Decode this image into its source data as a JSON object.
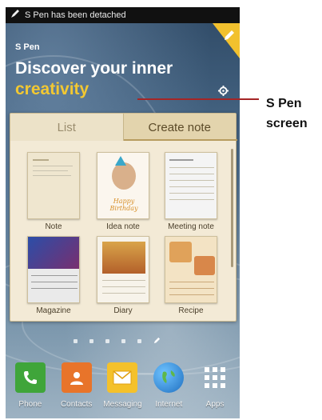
{
  "status_bar": {
    "notification": "S Pen has been detached",
    "icon": "pen-icon"
  },
  "header": {
    "small_title": "S Pen",
    "title_line1": "Discover your inner",
    "title_line2": "creativity"
  },
  "tabs": {
    "list": "List",
    "create": "Create note",
    "active": "Create note"
  },
  "templates": [
    {
      "label": "Note"
    },
    {
      "label": "Idea note"
    },
    {
      "label": "Meeting note"
    },
    {
      "label": "Magazine"
    },
    {
      "label": "Diary"
    },
    {
      "label": "Recipe"
    }
  ],
  "thumbnail_text": {
    "idea_note_caption": "Happy Birthday"
  },
  "dock": [
    {
      "label": "Phone",
      "icon": "phone-icon",
      "color": "#3fa53a"
    },
    {
      "label": "Contacts",
      "icon": "contacts-icon",
      "color": "#e8742a"
    },
    {
      "label": "Messaging",
      "icon": "messaging-icon",
      "color": "#f4c12b"
    },
    {
      "label": "Internet",
      "icon": "globe-icon",
      "color": "#2a87d6"
    },
    {
      "label": "Apps",
      "icon": "apps-grid-icon",
      "color": "#ffffff"
    }
  ],
  "callout": {
    "line1": "S Pen",
    "line2": "screen"
  },
  "colors": {
    "accent": "#f2c832",
    "callout_line": "#a52526",
    "panel": "#f3ead6"
  }
}
